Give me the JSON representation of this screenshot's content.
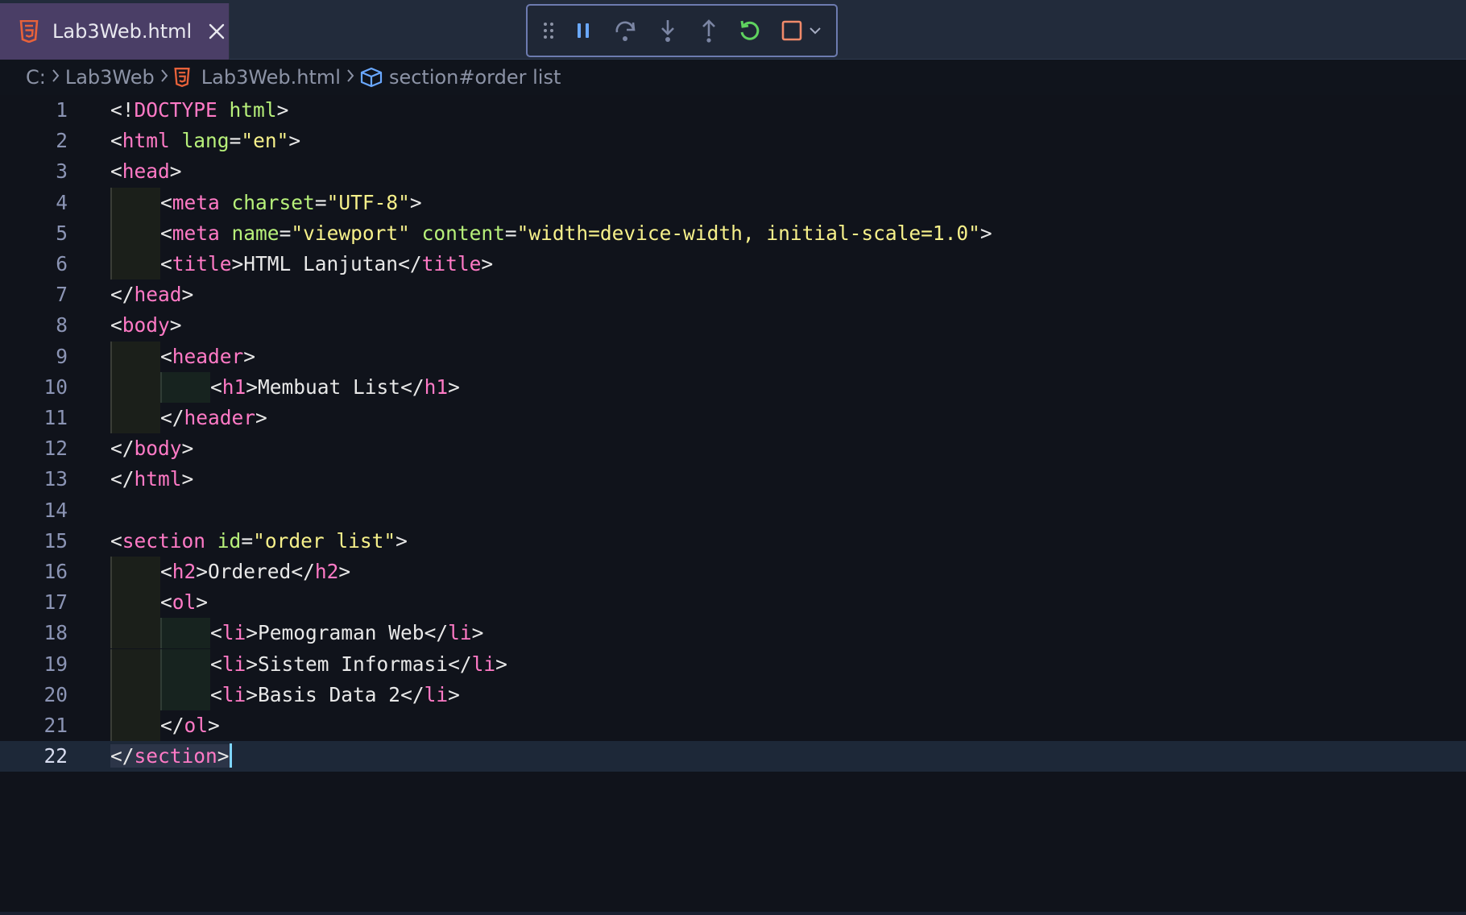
{
  "tab": {
    "title": "Lab3Web.html",
    "icon": "html5-icon",
    "close_icon": "close-icon"
  },
  "debug_toolbar": {
    "buttons": [
      {
        "name": "drag-handle-icon"
      },
      {
        "name": "pause-icon"
      },
      {
        "name": "step-over-icon"
      },
      {
        "name": "step-into-icon"
      },
      {
        "name": "step-out-icon"
      },
      {
        "name": "restart-icon"
      },
      {
        "name": "stop-icon"
      },
      {
        "name": "chevron-down-icon"
      }
    ],
    "colors": {
      "restart": "#5fd35f",
      "stop": "#f08a6a",
      "accent": "#6aa8ff"
    }
  },
  "breadcrumb": {
    "drive": "C:",
    "folder": "Lab3Web",
    "file": "Lab3Web.html",
    "symbol": "section#order list"
  },
  "editor": {
    "current_line": 22,
    "lines": [
      {
        "n": "1",
        "text": "<!DOCTYPE html>"
      },
      {
        "n": "2",
        "text": "<html lang=\"en\">"
      },
      {
        "n": "3",
        "text": "<head>"
      },
      {
        "n": "4",
        "text": "<meta charset=\"UTF-8\">"
      },
      {
        "n": "5",
        "text": "<meta name=\"viewport\" content=\"width=device-width, initial-scale=1.0\">"
      },
      {
        "n": "6",
        "text": "<title>HTML Lanjutan</title>"
      },
      {
        "n": "7",
        "text": "</head>"
      },
      {
        "n": "8",
        "text": "<body>"
      },
      {
        "n": "9",
        "text": "<header>"
      },
      {
        "n": "10",
        "text": "<h1>Membuat List</h1>"
      },
      {
        "n": "11",
        "text": "</header>"
      },
      {
        "n": "12",
        "text": "</body>"
      },
      {
        "n": "13",
        "text": "</html>"
      },
      {
        "n": "14",
        "text": ""
      },
      {
        "n": "15",
        "text": "<section id=\"order list\">"
      },
      {
        "n": "16",
        "text": "<h2>Ordered</h2>"
      },
      {
        "n": "17",
        "text": "<ol>"
      },
      {
        "n": "18",
        "text": "<li>Pemograman Web</li>"
      },
      {
        "n": "19",
        "text": "<li>Sistem Informasi</li>"
      },
      {
        "n": "20",
        "text": "<li>Basis Data 2</li>"
      },
      {
        "n": "21",
        "text": "</ol>"
      },
      {
        "n": "22",
        "text": "</section>"
      }
    ],
    "colors": {
      "tag": "#ff7ac6",
      "attribute": "#b7f07a",
      "string": "#f6f08a",
      "text": "#e8e8e8",
      "line_number": "#8b94b4"
    }
  }
}
